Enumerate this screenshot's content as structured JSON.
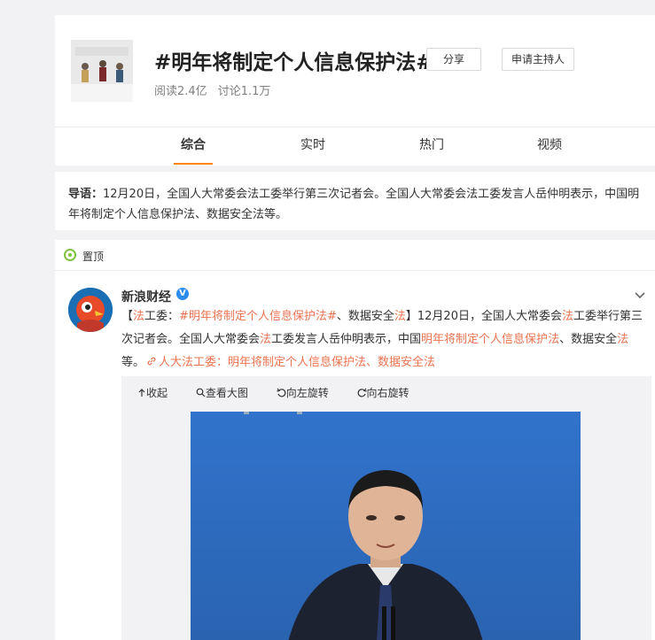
{
  "topic": {
    "title": "#明年将制定个人信息保护法#",
    "share_label": "分享",
    "host_label": "申请主持人",
    "reads": "阅读2.4亿",
    "discussions": "讨论1.1万",
    "thumb_text": "个人信息"
  },
  "tabs": [
    {
      "label": "综合"
    },
    {
      "label": "实时"
    },
    {
      "label": "热门"
    },
    {
      "label": "视频"
    }
  ],
  "intro": {
    "lead": "导语：",
    "text": "12月20日，全国人大常委会法工委举行第三次记者会。全国人大常委会法工委发言人岳仲明表示，中国明年将制定个人信息保护法、数据安全法等。"
  },
  "feed": {
    "pin_label": "置顶",
    "post": {
      "author": "新浪财经",
      "verified_mark": "V",
      "bracket_open": "【",
      "kw1": "法",
      "t1": "工委：",
      "topic_tag": "#明年将制定个人信息保护法#",
      "t2": "、数据安全",
      "kw2": "法",
      "bracket_close": "】",
      "t3": "12月20日，全国人大常委会",
      "kw3": "法",
      "t4": "工委举行第三次记者会。全国人大常委会",
      "kw4": "法",
      "t5": "工委发言人岳仲明表示，中国",
      "topic_tag2": "明年将制定个人信息保护",
      "kw5": "法",
      "t6": "、数据安全",
      "kw6": "法",
      "t7": "等。",
      "link_text": "人大法工委：明年将制定个人信息保护法、数据安全法"
    },
    "media_tools": {
      "collapse": "收起",
      "view_large": "查看大图",
      "rotate_left": "向左旋转",
      "rotate_right": "向右旋转"
    }
  },
  "colors": {
    "accent": "#ff8200",
    "highlight": "#eb7350",
    "verified": "#2d8cf0",
    "photo_bg": "#2e6cc2"
  }
}
